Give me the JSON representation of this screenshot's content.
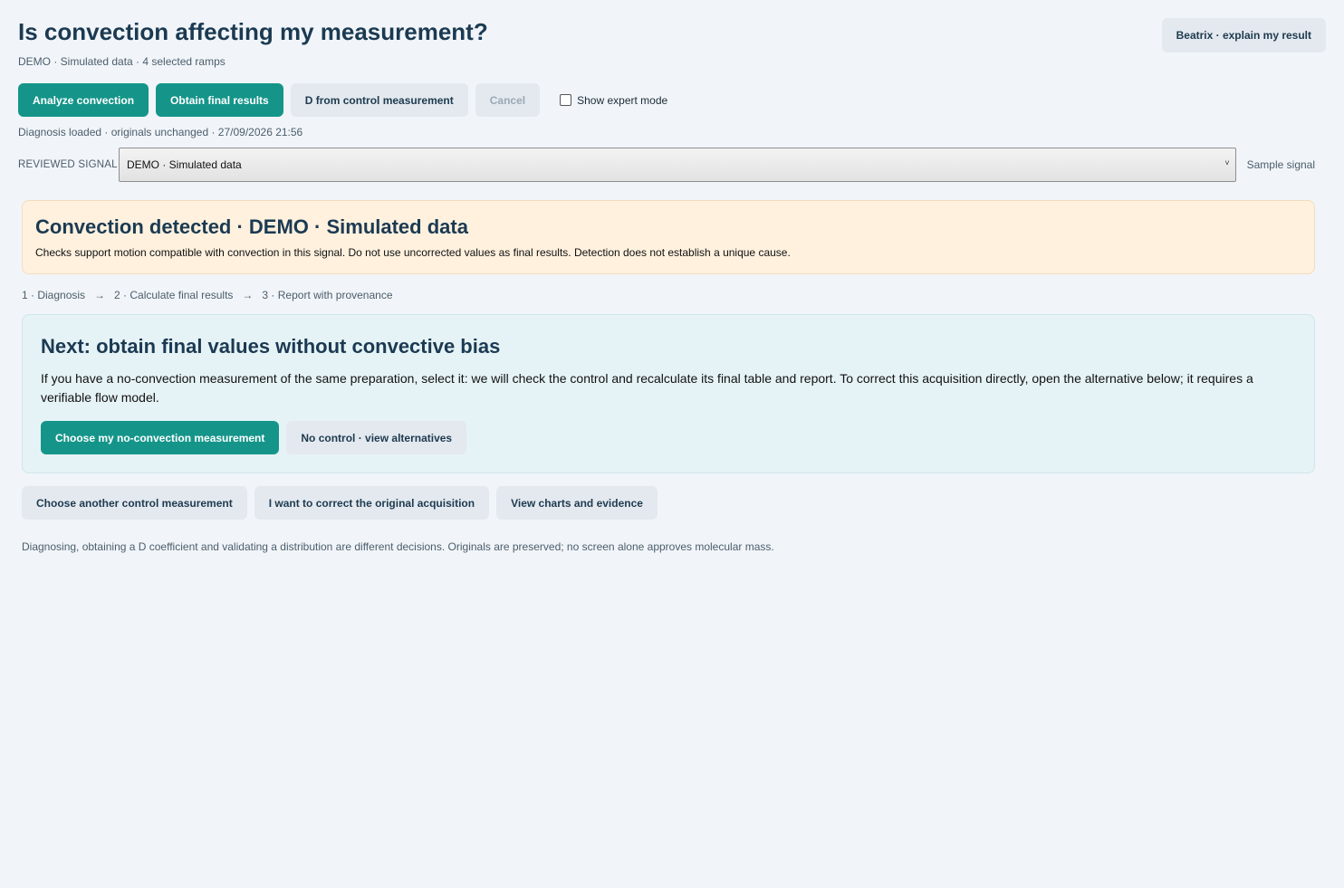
{
  "header": {
    "title": "Is convection affecting my measurement?",
    "subtitle": "DEMO · Simulated data · 4 selected ramps",
    "assistant_button": "Beatrix · explain my result"
  },
  "toolbar": {
    "analyze": "Analyze convection",
    "obtain": "Obtain final results",
    "control": "D from control measurement",
    "cancel": "Cancel",
    "expert_mode": "Show expert mode"
  },
  "status": "Diagnosis loaded · originals unchanged · 27/09/2026 21:56",
  "signal": {
    "label": "REVIEWED SIGNAL",
    "selected": "DEMO · Simulated data",
    "link": "Sample signal"
  },
  "alert": {
    "title": "Convection detected · DEMO · Simulated data",
    "text": "Checks support motion compatible with convection in this signal. Do not use uncorrected values as final results. Detection does not establish a unique cause."
  },
  "steps": {
    "s1": "1 · Diagnosis",
    "arrow": "→",
    "s2": "2 · Calculate final results",
    "s3": "3 · Report with provenance"
  },
  "next": {
    "title": "Next: obtain final values without convective bias",
    "text": "If you have a no-convection measurement of the same preparation, select it: we will check the control and recalculate its final table and report. To correct this acquisition directly, open the alternative below; it requires a verifiable flow model.",
    "primary": "Choose my no-convection measurement",
    "secondary": "No control · view alternatives"
  },
  "more_actions": {
    "another_control": "Choose another control measurement",
    "correct_original": "I want to correct the original acquisition",
    "view_charts": "View charts and evidence"
  },
  "footnote": "Diagnosing, obtaining a D coefficient and validating a distribution are different decisions. Originals are preserved; no screen alone approves molecular mass.",
  "colors": {
    "primary": "#15958a",
    "alert_bg": "#fff1de",
    "next_bg": "#e6f3f6",
    "page_bg": "#f1f5f9"
  }
}
